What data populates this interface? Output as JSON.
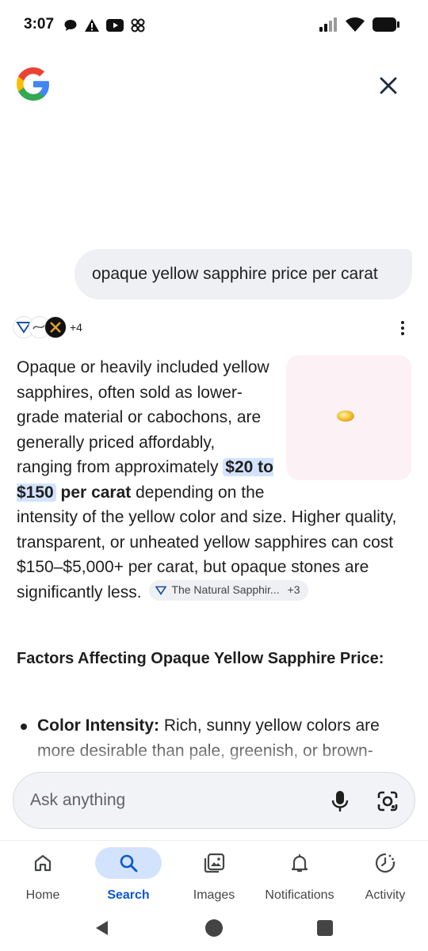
{
  "status_bar": {
    "time": "3:07"
  },
  "header": {
    "logo_icon": "google-g-icon",
    "close_icon": "close-icon"
  },
  "query": {
    "text": "opaque yellow sapphire price per carat"
  },
  "sources": {
    "more_count": "+4"
  },
  "answer": {
    "p1": "Opaque or heavily included yellow sapphires, often sold as lower-grade material or cabochons, are generally priced affordably, ranging from approximately ",
    "highlight": "$20 to $150",
    "bold1": " per carat",
    "p2": " depending on the intensity of the yellow color and size. Higher quality, transparent, or unheated yellow sapphires can cost $150–$5,000+ per carat, but opaque stones are significantly less.",
    "chip_label": "The Natural Sapphir...",
    "chip_count": "+3",
    "section_title": "Factors Affecting Opaque Yellow Sapphire Price:",
    "bullet_label": "Color Intensity:",
    "bullet_text": " Rich, sunny yellow colors are more desirable than pale, greenish, or brown-"
  },
  "ask": {
    "placeholder": "Ask anything"
  },
  "bottom_nav": {
    "items": [
      {
        "label": "Home",
        "icon": "home-icon"
      },
      {
        "label": "Search",
        "icon": "search-icon"
      },
      {
        "label": "Images",
        "icon": "images-icon"
      },
      {
        "label": "Notifications",
        "icon": "bell-icon"
      },
      {
        "label": "Activity",
        "icon": "activity-icon"
      }
    ],
    "active": "Search"
  },
  "colors": {
    "accent": "#0b57d0",
    "highlight_bg": "#d3e3fd",
    "bubble_bg": "#eef0f3"
  }
}
